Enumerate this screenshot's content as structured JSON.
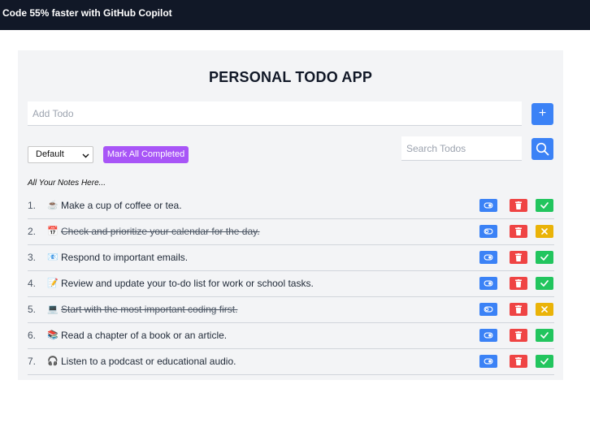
{
  "banner": {
    "text": "Code 55% faster with GitHub Copilot"
  },
  "app": {
    "title": "PERSONAL TODO APP",
    "add_placeholder": "Add Todo",
    "add_label": "+",
    "filter_value": "Default",
    "mark_all_label": "Mark All Completed",
    "search_placeholder": "Search Todos",
    "subtitle": "All Your Notes Here..."
  },
  "colors": {
    "accent": "#3b82f6",
    "delete": "#ef4444",
    "done": "#22c55e",
    "undo": "#eab308",
    "mark_all": "#a855f7"
  },
  "todos": [
    {
      "num": "1.",
      "emoji": "☕",
      "text": "Make a cup of coffee or tea.",
      "completed": false
    },
    {
      "num": "2.",
      "emoji": "📅",
      "text": "Check and prioritize your calendar for the day.",
      "completed": true
    },
    {
      "num": "3.",
      "emoji": "📧",
      "text": "Respond to important emails.",
      "completed": false
    },
    {
      "num": "4.",
      "emoji": "📝",
      "text": "Review and update your to-do list for work or school tasks.",
      "completed": false
    },
    {
      "num": "5.",
      "emoji": "💻",
      "text": "Start with the most important coding first.",
      "completed": true
    },
    {
      "num": "6.",
      "emoji": "📚",
      "text": "Read a chapter of a book or an article.",
      "completed": false
    },
    {
      "num": "7.",
      "emoji": "🎧",
      "text": "Listen to a podcast or educational audio.",
      "completed": false
    }
  ]
}
